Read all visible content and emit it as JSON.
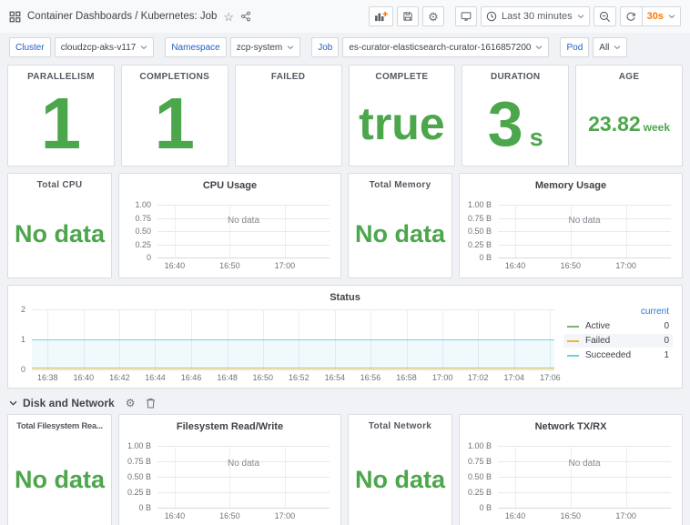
{
  "header": {
    "title": "Container Dashboards / Kubernetes: Job",
    "time_range": "Last 30 minutes",
    "refresh_interval": "30s"
  },
  "variables": [
    {
      "label": "Cluster",
      "value": "cloudzcp-aks-v117"
    },
    {
      "label": "Namespace",
      "value": "zcp-system"
    },
    {
      "label": "Job",
      "value": "es-curator-elasticsearch-curator-1616857200"
    },
    {
      "label": "Pod",
      "value": "All"
    }
  ],
  "stats": [
    {
      "title": "PARALLELISM",
      "value": "1"
    },
    {
      "title": "COMPLETIONS",
      "value": "1"
    },
    {
      "title": "FAILED",
      "value": ""
    },
    {
      "title": "COMPLETE",
      "value": "true"
    },
    {
      "title": "DURATION",
      "value": "3",
      "unit": "s"
    },
    {
      "title": "AGE",
      "value": "23.82",
      "unit": "week"
    }
  ],
  "no_data_panels": {
    "total_cpu": {
      "title": "Total CPU",
      "value": "No data"
    },
    "total_memory": {
      "title": "Total Memory",
      "value": "No data"
    },
    "total_filesystem": {
      "title": "Total Filesystem Rea...",
      "value": "No data"
    },
    "total_network": {
      "title": "Total Network",
      "value": "No data"
    }
  },
  "section": {
    "title": "Disk and Network"
  },
  "charts": {
    "cpu_usage": {
      "type": "line",
      "title": "CPU Usage",
      "no_data": "No data",
      "y_ticks": [
        "1.00",
        "0.75",
        "0.50",
        "0.25",
        "0"
      ],
      "x_ticks": [
        "16:40",
        "16:50",
        "17:00"
      ],
      "x_fracs": [
        0.1,
        0.42,
        0.74
      ],
      "series": []
    },
    "memory_usage": {
      "type": "line",
      "title": "Memory Usage",
      "no_data": "No data",
      "y_ticks": [
        "1.00 B",
        "0.75 B",
        "0.50 B",
        "0.25 B",
        "0 B"
      ],
      "x_ticks": [
        "16:40",
        "16:50",
        "17:00"
      ],
      "x_fracs": [
        0.1,
        0.42,
        0.74
      ],
      "series": []
    },
    "status": {
      "type": "line",
      "title": "Status",
      "y_max": 2,
      "y_ticks": [
        "2",
        "1",
        "0"
      ],
      "x_ticks": [
        "16:38",
        "16:40",
        "16:42",
        "16:44",
        "16:46",
        "16:48",
        "16:50",
        "16:52",
        "16:54",
        "16:56",
        "16:58",
        "17:00",
        "17:02",
        "17:04",
        "17:06"
      ],
      "x_fracs": [
        0.03,
        0.099,
        0.168,
        0.236,
        0.305,
        0.374,
        0.442,
        0.511,
        0.58,
        0.648,
        0.717,
        0.786,
        0.854,
        0.923,
        0.992
      ],
      "legend_header": "current",
      "series": [
        {
          "name": "Active",
          "color": "#7EB26D",
          "value": 0,
          "current": "0"
        },
        {
          "name": "Failed",
          "color": "#EAB839",
          "value": 0,
          "current": "0"
        },
        {
          "name": "Succeeded",
          "color": "#6ED0E0",
          "value": 1,
          "current": "1",
          "fill": "rgba(110,208,224,0.10)"
        }
      ]
    },
    "fs_rw": {
      "type": "line",
      "title": "Filesystem Read/Write",
      "no_data": "No data",
      "y_ticks": [
        "1.00 B",
        "0.75 B",
        "0.50 B",
        "0.25 B",
        "0 B"
      ],
      "x_ticks": [
        "16:40",
        "16:50",
        "17:00"
      ],
      "x_fracs": [
        0.1,
        0.42,
        0.74
      ],
      "series": []
    },
    "net_txrx": {
      "type": "line",
      "title": "Network TX/RX",
      "no_data": "No data",
      "y_ticks": [
        "1.00 B",
        "0.75 B",
        "0.50 B",
        "0.25 B",
        "0 B"
      ],
      "x_ticks": [
        "16:40",
        "16:50",
        "17:00"
      ],
      "x_fracs": [
        0.1,
        0.42,
        0.74
      ],
      "series": []
    }
  }
}
